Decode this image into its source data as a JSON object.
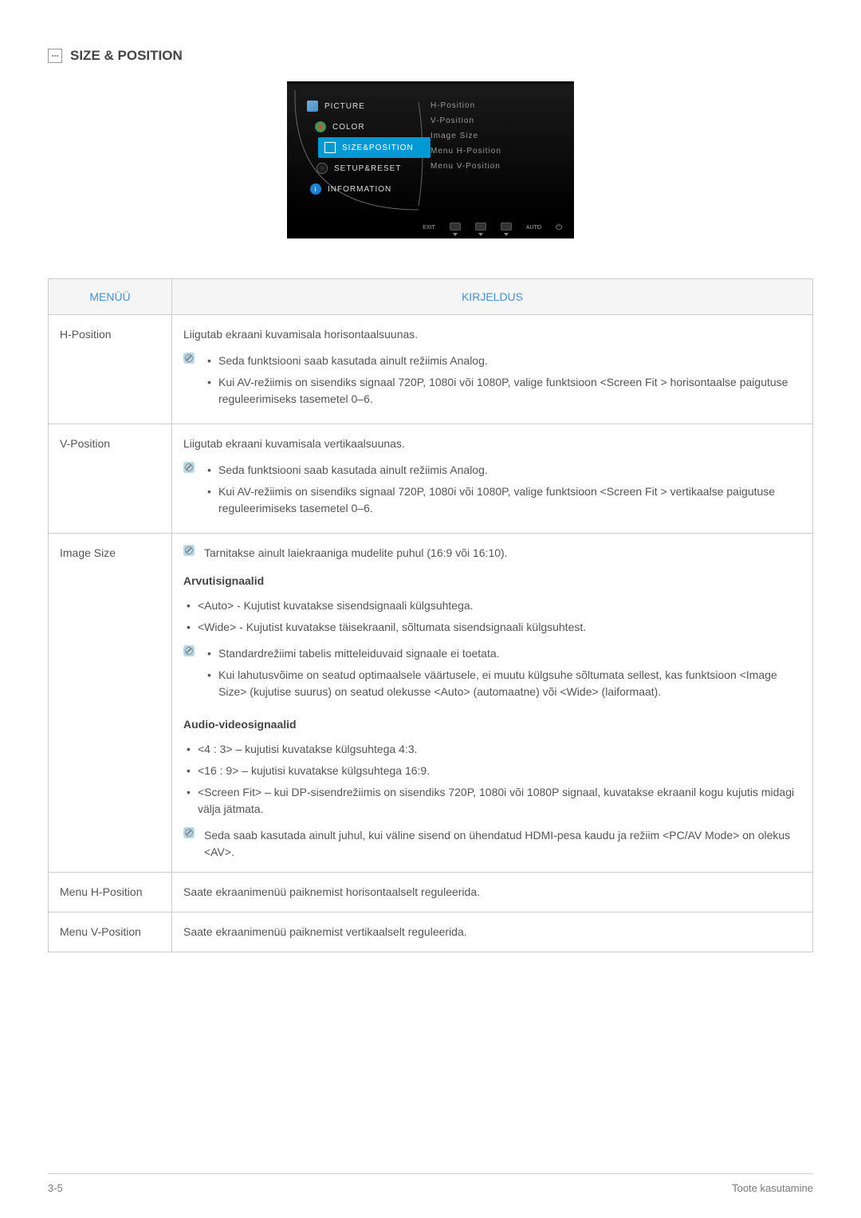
{
  "header": {
    "title": "SIZE & POSITION"
  },
  "osd": {
    "left_menu": [
      {
        "label": "PICTURE"
      },
      {
        "label": "COLOR"
      },
      {
        "label": "SIZE&POSITION"
      },
      {
        "label": "SETUP&RESET"
      },
      {
        "label": "INFORMATION"
      }
    ],
    "right_menu": [
      "H-Position",
      "V-Position",
      "Image Size",
      "Menu H-Position",
      "Menu V-Position"
    ],
    "footer": [
      "EXIT",
      "",
      "",
      "",
      "AUTO",
      ""
    ]
  },
  "table": {
    "headers": {
      "menu": "MENÜÜ",
      "desc": "KIRJELDUS"
    },
    "rows": [
      {
        "name": "H-Position",
        "intro": "Liigutab ekraani kuvamisala horisontaalsuunas.",
        "notes": [
          "Seda funktsiooni saab kasutada ainult režiimis Analog.",
          "Kui AV-režiimis on sisendiks signaal 720P, 1080i või 1080P, valige funktsioon <Screen Fit > horisontaalse paigutuse reguleerimiseks tasemetel 0–6."
        ]
      },
      {
        "name": "V-Position",
        "intro": "Liigutab ekraani kuvamisala vertikaalsuunas.",
        "notes": [
          "Seda funktsiooni saab kasutada ainult režiimis Analog.",
          "Kui AV-režiimis on sisendiks signaal 720P, 1080i või 1080P, valige funktsioon <Screen Fit > vertikaalse paigutuse reguleerimiseks tasemetel 0–6."
        ]
      },
      {
        "name": "Image Size",
        "note_single": "Tarnitakse ainult laiekraaniga mudelite puhul (16:9 või 16:10).",
        "sub1_title": "Arvutisignaalid",
        "sub1_items": [
          "<Auto> - Kujutist kuvatakse sisendsignaali külgsuhtega.",
          "<Wide> - Kujutist kuvatakse täisekraanil, sõltumata sisendsignaali külgsuhtest."
        ],
        "sub1_notes": [
          "Standardrežiimi tabelis mitteleiduvaid signaale ei toetata.",
          "Kui lahutusvõime on seatud optimaalsele väärtusele, ei muutu külgsuhe sõltumata sellest, kas funktsioon <Image Size> (kujutise suurus) on seatud olekusse <Auto> (automaatne) või <Wide> (laiformaat)."
        ],
        "sub2_title": "Audio-videosignaalid",
        "sub2_items": [
          "<4 : 3> – kujutisi kuvatakse külgsuhtega 4:3.",
          "<16 : 9> – kujutisi kuvatakse külgsuhtega 16:9.",
          "<Screen Fit> – kui DP-sisendrežiimis on sisendiks 720P, 1080i või 1080P signaal, kuvatakse ekraanil kogu kujutis midagi välja jätmata."
        ],
        "sub2_note": "Seda saab kasutada ainult juhul, kui väline sisend on ühendatud HDMI-pesa kaudu ja režiim <PC/AV Mode> on olekus <AV>."
      },
      {
        "name": "Menu H-Position",
        "intro": "Saate ekraanimenüü paiknemist horisontaalselt reguleerida."
      },
      {
        "name": "Menu V-Position",
        "intro": "Saate ekraanimenüü paiknemist vertikaalselt reguleerida."
      }
    ]
  },
  "footer": {
    "left": "3-5",
    "right": "Toote kasutamine"
  }
}
